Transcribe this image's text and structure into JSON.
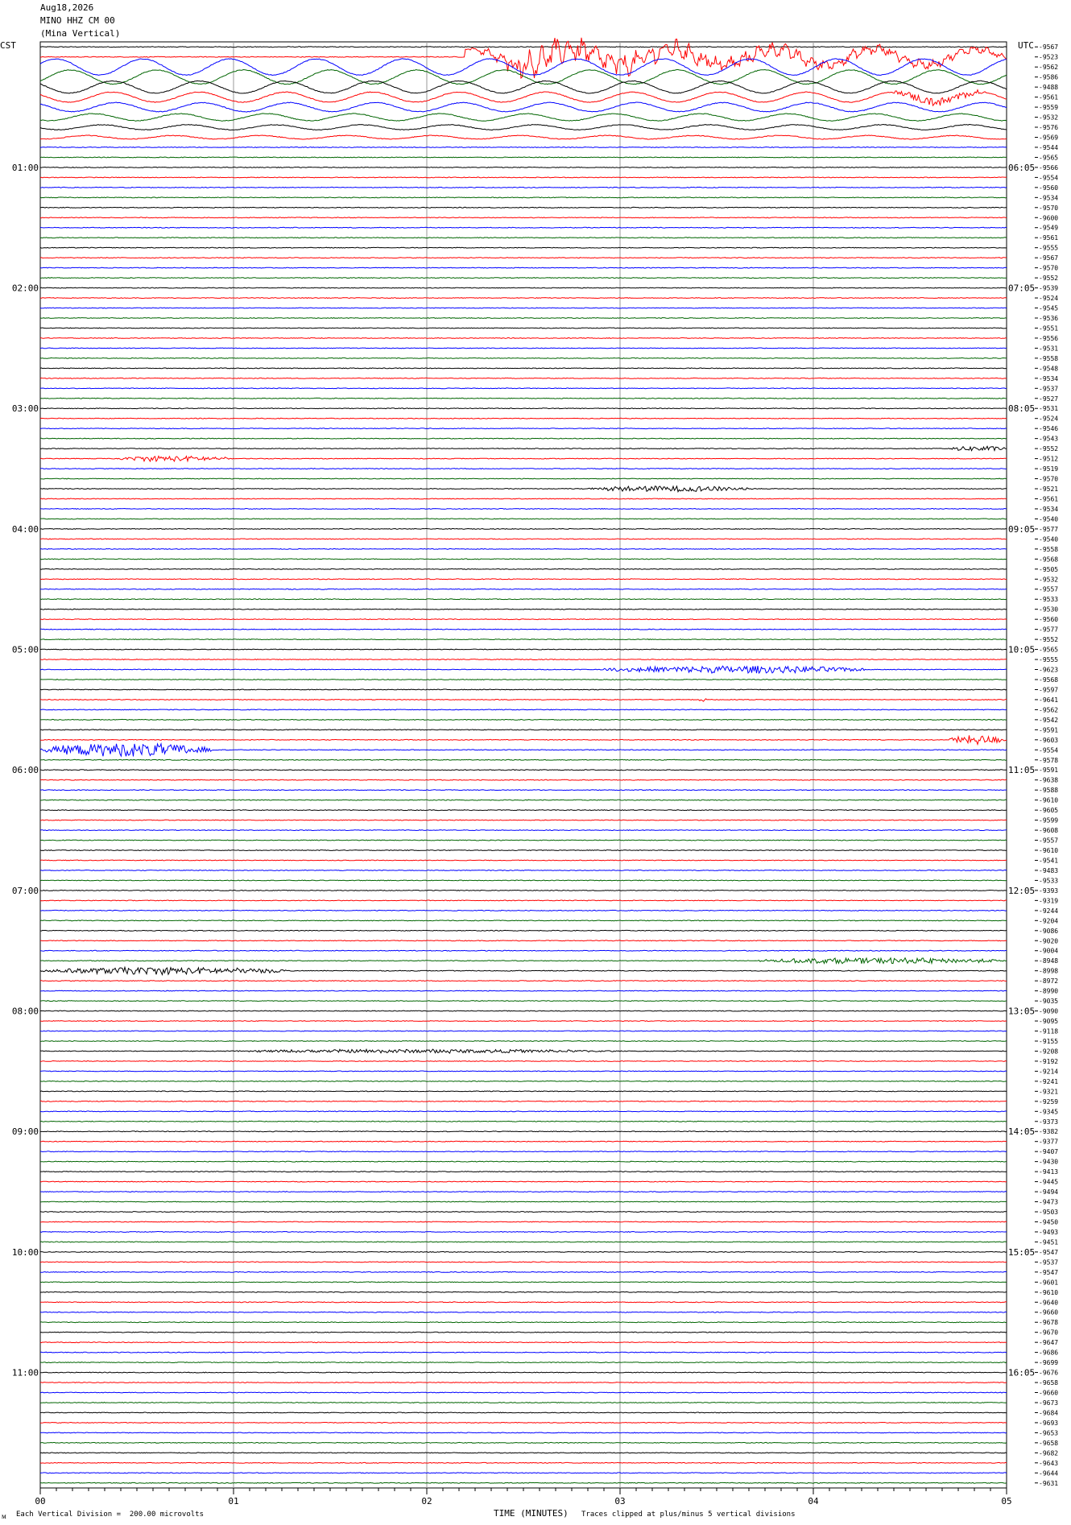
{
  "header": {
    "date": "Aug18,2026",
    "station": "MINO HHZ CM 00",
    "name": "(Mina Vertical)"
  },
  "left_tz": "CST",
  "right_tz": "UTC",
  "footer": {
    "scale_note": "Each Vertical Division =  200.00 microvolts",
    "clip_note": "Traces clipped at plus/minus 5 vertical divisions",
    "mark": "ᴍ"
  },
  "colors": {
    "black": "#000000",
    "red": "#ff0000",
    "blue": "#0000ff",
    "green": "#006400",
    "grid": "#9a9a9a"
  },
  "chart_data": {
    "type": "line",
    "title": "",
    "xlabel": "TIME (MINUTES)",
    "ylabel": "",
    "xlim": [
      0,
      5
    ],
    "x_ticks": [
      "00",
      "01",
      "02",
      "03",
      "04",
      "05"
    ],
    "trace_count": 144,
    "color_cycle": [
      "black",
      "red",
      "blue",
      "green"
    ],
    "left_hour_labels": [
      "01:00",
      "02:00",
      "03:00",
      "04:00",
      "05:00",
      "06:00",
      "07:00",
      "08:00",
      "09:00",
      "10:00",
      "11:00"
    ],
    "right_hour_labels": [
      "06:05",
      "07:05",
      "08:05",
      "09:05",
      "10:05",
      "11:05",
      "12:05",
      "13:05",
      "14:05",
      "15:05",
      "16:05"
    ],
    "right_top_label": "",
    "trace_values": [
      -9567,
      -9523,
      -9562,
      -9586,
      -9488,
      -9561,
      -9559,
      -9532,
      -9576,
      -9569,
      -9544,
      -9565,
      -9566,
      -9554,
      -9560,
      -9534,
      -9570,
      -9600,
      -9549,
      -9561,
      -9555,
      -9567,
      -9570,
      -9552,
      -9539,
      -9524,
      -9545,
      -9536,
      -9551,
      -9556,
      -9531,
      -9558,
      -9548,
      -9534,
      -9537,
      -9527,
      -9531,
      -9524,
      -9546,
      -9543,
      -9552,
      -9512,
      -9519,
      -9570,
      -9521,
      -9561,
      -9534,
      -9540,
      -9577,
      -9540,
      -9558,
      -9568,
      -9505,
      -9532,
      -9557,
      -9533,
      -9530,
      -9560,
      -9577,
      -9552,
      -9565,
      -9555,
      -9623,
      -9568,
      -9597,
      -9641,
      -9562,
      -9542,
      -9591,
      -9603,
      -9554,
      -9578,
      -9591,
      -9638,
      -9588,
      -9610,
      -9605,
      -9599,
      -9608,
      -9557,
      -9610,
      -9541,
      -9483,
      -9533,
      -9393,
      -9319,
      -9244,
      -9204,
      -9086,
      -9020,
      -9004,
      -8948,
      -8998,
      -8972,
      -8990,
      -9035,
      -9090,
      -9095,
      -9118,
      -9155,
      -9208,
      -9192,
      -9214,
      -9241,
      -9321,
      -9259,
      -9345,
      -9373,
      -9382,
      -9377,
      -9407,
      -9430,
      -9413,
      -9445,
      -9494,
      -9473,
      -9503,
      -9450,
      -9493,
      -9451,
      -9547,
      -9537,
      -9547,
      -9601,
      -9610,
      -9640,
      -9660,
      -9678,
      -9670,
      -9647,
      -9686,
      -9699,
      -9676,
      -9658,
      -9660,
      -9673,
      -9684,
      -9693,
      -9653,
      -9658,
      -9682,
      -9643,
      -9644,
      -9631,
      -9667
    ],
    "events": [
      {
        "trace": 1,
        "start": 2.2,
        "end": 5.0,
        "amp": 2.6,
        "kind": "quake"
      },
      {
        "trace": 2,
        "start": 0.0,
        "end": 5.0,
        "amp": 1.6,
        "kind": "swell"
      },
      {
        "trace": 3,
        "start": 0.0,
        "end": 5.0,
        "amp": 1.4,
        "kind": "swell"
      },
      {
        "trace": 4,
        "start": 0.0,
        "end": 5.0,
        "amp": 1.2,
        "kind": "swell"
      },
      {
        "trace": 5,
        "start": 0.0,
        "end": 5.0,
        "amp": 1.0,
        "kind": "swell"
      },
      {
        "trace": 5,
        "start": 4.4,
        "end": 4.9,
        "amp": 0.8,
        "kind": "burst"
      },
      {
        "trace": 6,
        "start": 0.0,
        "end": 5.0,
        "amp": 0.9,
        "kind": "swell"
      },
      {
        "trace": 7,
        "start": 0.0,
        "end": 5.0,
        "amp": 0.7,
        "kind": "swell"
      },
      {
        "trace": 8,
        "start": 0.0,
        "end": 5.0,
        "amp": 0.5,
        "kind": "swell"
      },
      {
        "trace": 9,
        "start": 0.0,
        "end": 5.0,
        "amp": 0.35,
        "kind": "swell"
      },
      {
        "trace": 40,
        "start": 4.7,
        "end": 5.0,
        "amp": 0.5,
        "kind": "burst"
      },
      {
        "trace": 41,
        "start": 0.4,
        "end": 1.0,
        "amp": 0.55,
        "kind": "burst"
      },
      {
        "trace": 44,
        "start": 2.8,
        "end": 3.7,
        "amp": 0.55,
        "kind": "burst"
      },
      {
        "trace": 62,
        "start": 2.9,
        "end": 4.3,
        "amp": 0.7,
        "kind": "burst"
      },
      {
        "trace": 65,
        "start": 3.4,
        "end": 3.45,
        "amp": 0.4,
        "kind": "burst"
      },
      {
        "trace": 69,
        "start": 4.7,
        "end": 5.0,
        "amp": 0.9,
        "kind": "burst"
      },
      {
        "trace": 70,
        "start": 0.0,
        "end": 0.9,
        "amp": 1.3,
        "kind": "burst"
      },
      {
        "trace": 91,
        "start": 3.7,
        "end": 5.0,
        "amp": 0.55,
        "kind": "burst"
      },
      {
        "trace": 92,
        "start": 0.0,
        "end": 1.3,
        "amp": 0.7,
        "kind": "burst"
      },
      {
        "trace": 100,
        "start": 1.0,
        "end": 3.0,
        "amp": 0.35,
        "kind": "burst"
      }
    ]
  }
}
